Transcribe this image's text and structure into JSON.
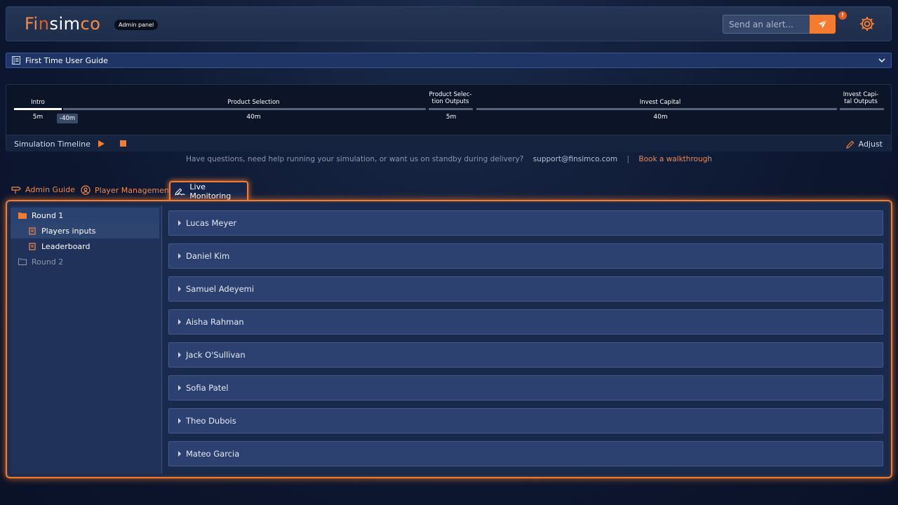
{
  "header": {
    "logo_parts": [
      "Fi",
      "n",
      "sim",
      "co"
    ],
    "badge": "Admin panel",
    "alert_placeholder": "Send an alert...",
    "alert_count": "!"
  },
  "guide": {
    "title": "First Time User Guide"
  },
  "timeline": {
    "segments": [
      {
        "label": "Intro",
        "time": "5m"
      },
      {
        "label": "Product Selection",
        "time": "40m"
      },
      {
        "label": "Product Selec-\ntion Outputs",
        "time": "5m"
      },
      {
        "label": "Invest Capital",
        "time": "40m"
      },
      {
        "label": "Invest Capi-\ntal Outputs",
        "time": ""
      }
    ],
    "offset": "-40m",
    "footer_title": "Simulation Timeline",
    "adjust_label": "Adjust"
  },
  "help": {
    "text": "Have questions, need help running your simulation, or want us on standby during delivery?",
    "email": "support@finsimco.com",
    "sep": "|",
    "book": "Book a walkthrough"
  },
  "tabs": {
    "admin_guide": "Admin Guide",
    "player_management": "Player Management",
    "live_monitoring": "Live Monitoring"
  },
  "sidebar": {
    "round1": "Round 1",
    "players_inputs": "Players inputs",
    "leaderboard": "Leaderboard",
    "round2": "Round 2"
  },
  "players": [
    "Lucas Meyer",
    "Daniel Kim",
    "Samuel Adeyemi",
    "Aisha Rahman",
    "Jack O'Sullivan",
    "Sofia Patel",
    "Theo Dubois",
    "Mateo Garcia"
  ],
  "colors": {
    "accent": "#f47b2f",
    "background": "#0d1730",
    "panel": "#1a2a4c"
  }
}
